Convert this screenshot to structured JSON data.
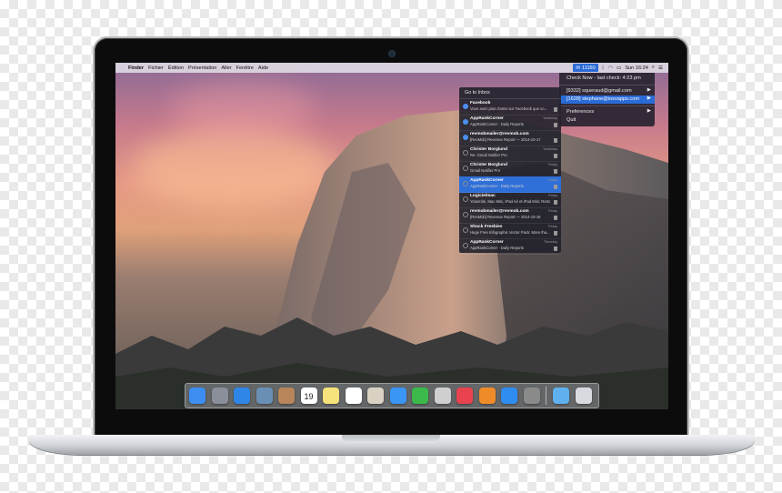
{
  "menubar": {
    "items": [
      "Finder",
      "Fichier",
      "Édition",
      "Présentation",
      "Aller",
      "Fenêtre",
      "Aide"
    ],
    "mail_count": "11160",
    "clock": "Sun 16:24"
  },
  "status_menu": {
    "check_now": "Check Now - last check: 4:23 pm",
    "accounts": [
      "[9332] squeraud@gmail.com",
      "[1628] stephane@iosvapps.com"
    ],
    "preferences": "Preferences",
    "quit": "Quit"
  },
  "panel": {
    "go_to_inbox": "Go to Inbox",
    "messages": [
      {
        "sender": "Facebook",
        "subject": "Vous avez plus d'amis sur Facebook que vo...",
        "time": "",
        "unread": true
      },
      {
        "sender": "AppRankCorner",
        "subject": "AppRankCorner - Daily Reports",
        "time": "Yesterday",
        "unread": true
      },
      {
        "sender": "revmobmailer@revmob.com",
        "subject": "[RevMob] Revenue Report — 2014-10-17",
        "time": "",
        "unread": true
      },
      {
        "sender": "Christer Borglund",
        "subject": "Re: Gmail Notifier Pro",
        "time": "Yesterday",
        "unread": false
      },
      {
        "sender": "Christer Borglund",
        "subject": "Gmail Notifier Pro",
        "time": "Friday",
        "unread": false
      },
      {
        "sender": "AppRankCorner",
        "subject": "AppRankCorner - Daily Reports",
        "time": "Friday",
        "unread": false
      },
      {
        "sender": "Logicielmac",
        "subject": "Yosemite, Mac Mini, iPad Air et iPad Mini: Retro...",
        "time": "Friday",
        "unread": false
      },
      {
        "sender": "revmobmailer@revmob.com",
        "subject": "[RevMob] Revenue Report — 2014-10-16",
        "time": "Friday",
        "unread": false
      },
      {
        "sender": "Shock Freebies",
        "subject": "Huge Free Infographic Vector Pack: More tha...",
        "time": "Friday",
        "unread": false
      },
      {
        "sender": "AppRankCorner",
        "subject": "AppRankCorner - Daily Reports",
        "time": "Thursday",
        "unread": false
      }
    ],
    "selected_index": 5
  },
  "dock": {
    "apps": [
      {
        "name": "finder-icon",
        "color": "#3d8ef0"
      },
      {
        "name": "launchpad-icon",
        "color": "#8a8f99"
      },
      {
        "name": "safari-icon",
        "color": "#2f86e6"
      },
      {
        "name": "preview-icon",
        "color": "#6a8fb5"
      },
      {
        "name": "contacts-icon",
        "color": "#b8865a"
      },
      {
        "name": "calendar-icon",
        "color": "#ffffff",
        "label": "19"
      },
      {
        "name": "notes-icon",
        "color": "#f6e27a"
      },
      {
        "name": "reminders-icon",
        "color": "#ffffff"
      },
      {
        "name": "photos-icon",
        "color": "#d9d1c2"
      },
      {
        "name": "messages-icon",
        "color": "#3b95f5"
      },
      {
        "name": "facetime-icon",
        "color": "#3bb94a"
      },
      {
        "name": "no-entry-icon",
        "color": "#cfcfcf"
      },
      {
        "name": "itunes-icon",
        "color": "#e8434f"
      },
      {
        "name": "ibooks-icon",
        "color": "#f08b2a"
      },
      {
        "name": "app-store-icon",
        "color": "#2f8cf0"
      },
      {
        "name": "system-preferences-icon",
        "color": "#8a8a8a"
      },
      {
        "name": "downloads-folder-icon",
        "color": "#5fb0ee"
      },
      {
        "name": "trash-icon",
        "color": "#d7dbe0"
      }
    ]
  },
  "colors": {
    "accent": "#2a6bd6",
    "panel": "#22222c"
  }
}
